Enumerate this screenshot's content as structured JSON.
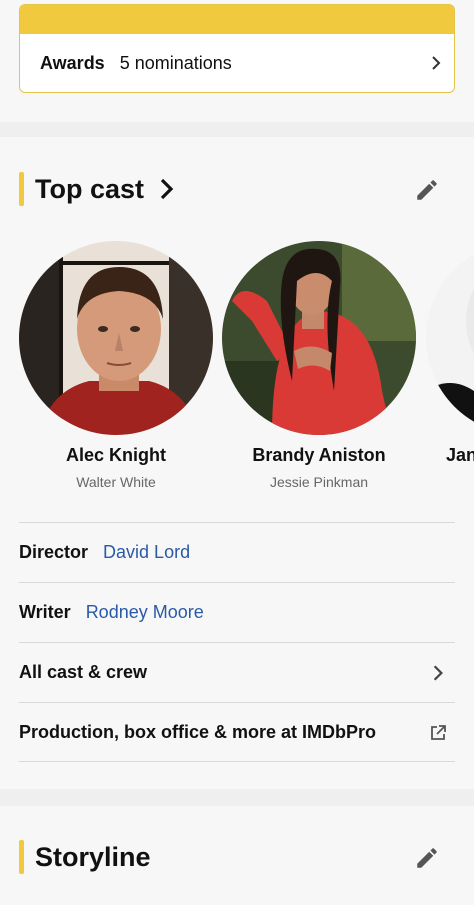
{
  "awards": {
    "label": "Awards",
    "value": "5 nominations"
  },
  "top_cast": {
    "title": "Top cast",
    "members": [
      {
        "name": "Alec Knight",
        "role": "Walter White"
      },
      {
        "name": "Brandy Aniston",
        "role": "Jessie Pinkman"
      },
      {
        "name": "Jan",
        "role": ""
      }
    ]
  },
  "credits": {
    "director_label": "Director",
    "director_value": "David Lord",
    "writer_label": "Writer",
    "writer_value": "Rodney Moore",
    "all_cast_label": "All cast & crew",
    "imdbpro_label": "Production, box office & more at IMDbPro"
  },
  "storyline": {
    "title": "Storyline"
  },
  "colors": {
    "accent": "#f0c93f",
    "link": "#2a5aa6",
    "section_bg": "#f7f7f7",
    "page_bg": "#efefef"
  }
}
